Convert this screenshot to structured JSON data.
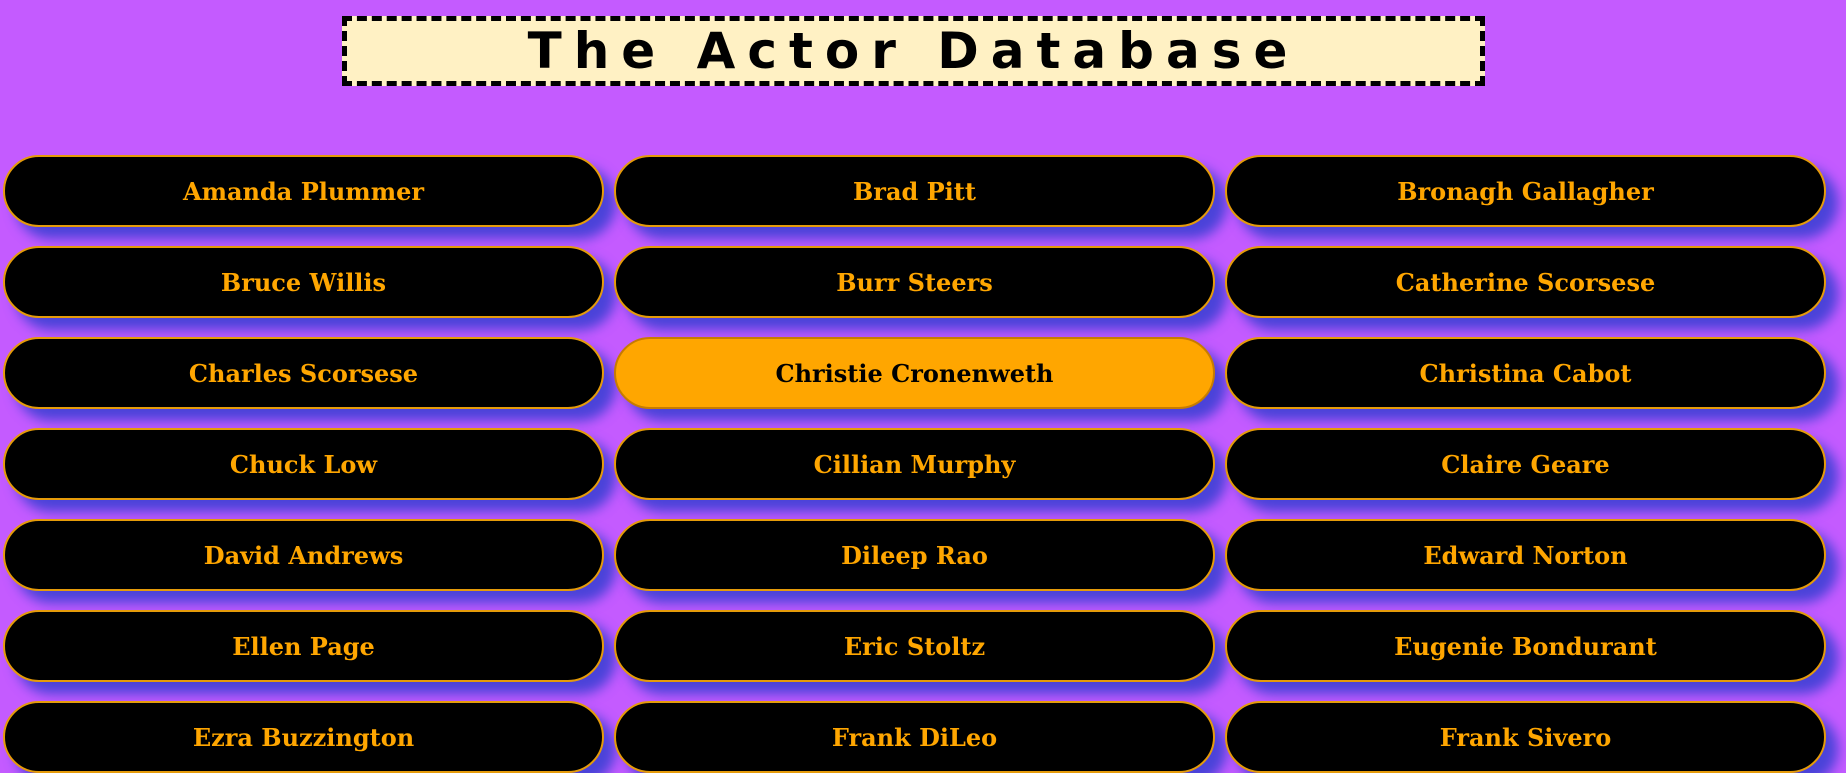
{
  "header": {
    "title": "The Actor Database"
  },
  "colors": {
    "background": "#c45bff",
    "button_bg": "#000000",
    "button_text": "#ffa600",
    "selected_bg": "#ffa600",
    "banner_bg": "#fff1c4"
  },
  "actors": [
    {
      "name": "Amanda Plummer",
      "selected": false
    },
    {
      "name": "Brad Pitt",
      "selected": false
    },
    {
      "name": "Bronagh Gallagher",
      "selected": false
    },
    {
      "name": "Bruce Willis",
      "selected": false
    },
    {
      "name": "Burr Steers",
      "selected": false
    },
    {
      "name": "Catherine Scorsese",
      "selected": false
    },
    {
      "name": "Charles Scorsese",
      "selected": false
    },
    {
      "name": "Christie Cronenweth",
      "selected": true
    },
    {
      "name": "Christina Cabot",
      "selected": false
    },
    {
      "name": "Chuck Low",
      "selected": false
    },
    {
      "name": "Cillian Murphy",
      "selected": false
    },
    {
      "name": "Claire Geare",
      "selected": false
    },
    {
      "name": "David Andrews",
      "selected": false
    },
    {
      "name": "Dileep Rao",
      "selected": false
    },
    {
      "name": "Edward Norton",
      "selected": false
    },
    {
      "name": "Ellen Page",
      "selected": false
    },
    {
      "name": "Eric Stoltz",
      "selected": false
    },
    {
      "name": "Eugenie Bondurant",
      "selected": false
    },
    {
      "name": "Ezra Buzzington",
      "selected": false
    },
    {
      "name": "Frank DiLeo",
      "selected": false
    },
    {
      "name": "Frank Sivero",
      "selected": false
    }
  ]
}
